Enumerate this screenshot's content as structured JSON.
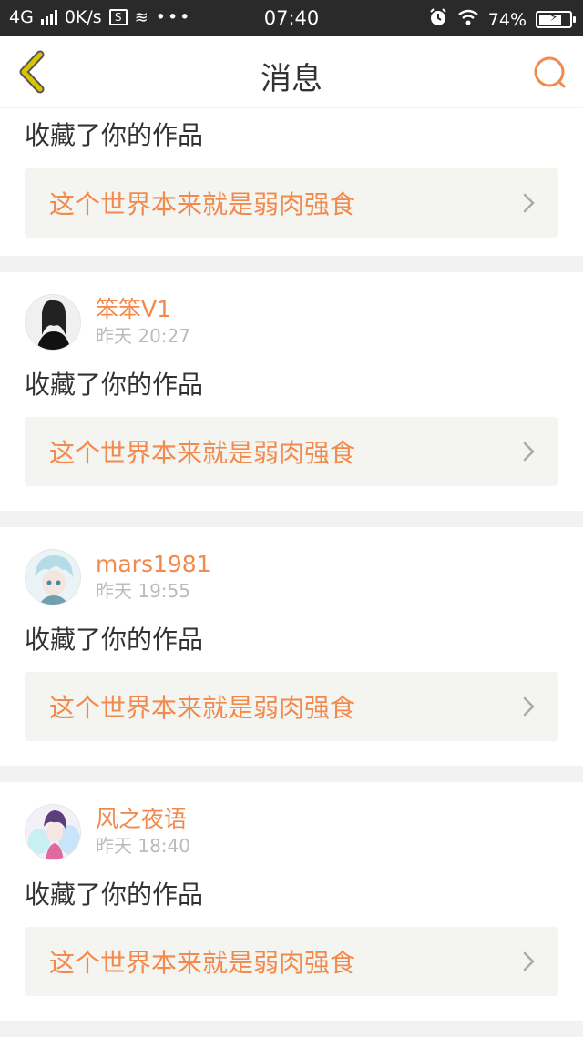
{
  "status_bar": {
    "network": "4G",
    "speed": "0K/s",
    "time": "07:40",
    "battery": "74%",
    "battery_level": 0.74
  },
  "navbar": {
    "title": "消息"
  },
  "items": [
    {
      "action": "收藏了你的作品",
      "work_title": "这个世界本来就是弱肉强食"
    },
    {
      "user": "笨笨V1",
      "time": "昨天 20:27",
      "action": "收藏了你的作品",
      "work_title": "这个世界本来就是弱肉强食"
    },
    {
      "user": "mars1981",
      "time": "昨天 19:55",
      "action": "收藏了你的作品",
      "work_title": "这个世界本来就是弱肉强食"
    },
    {
      "user": "风之夜语",
      "time": "昨天 18:40",
      "action": "收藏了你的作品",
      "work_title": "这个世界本来就是弱肉强食"
    }
  ],
  "colors": {
    "accent": "#f28a4e",
    "back_icon": "#c9b400",
    "status_bar_bg": "#2a2a2a"
  }
}
